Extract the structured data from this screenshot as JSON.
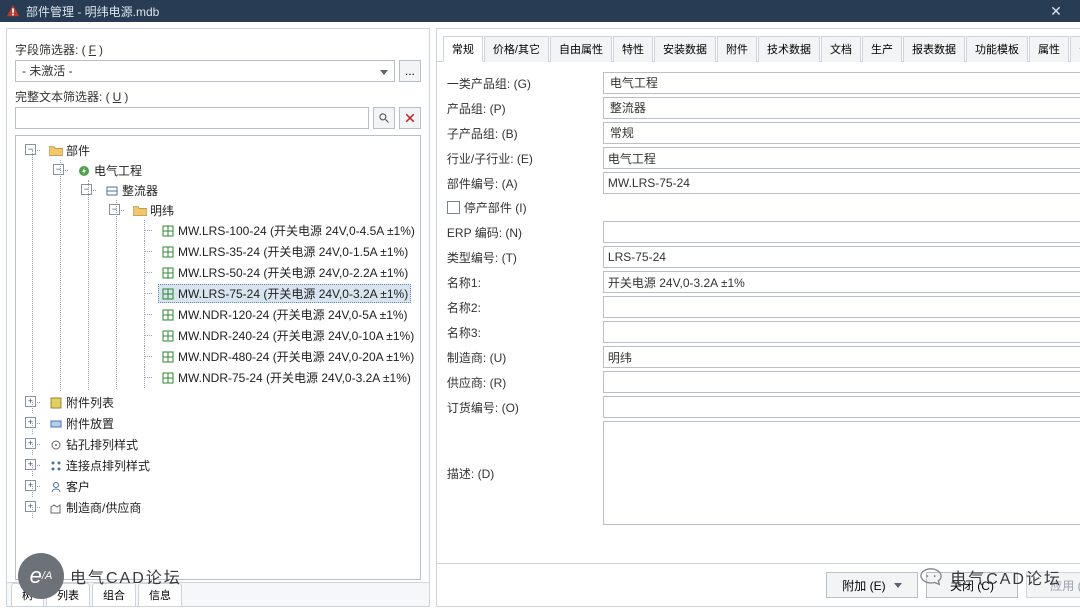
{
  "window": {
    "title": "部件管理 - 明纬电源.mdb"
  },
  "left": {
    "field_filter_label": "字段筛选器: (",
    "field_filter_u": "F",
    "field_filter_close": ")",
    "field_filter_value": "- 未激活 -",
    "full_filter_label": "完整文本筛选器: (",
    "full_filter_u": "U",
    "full_filter_close": ")",
    "root": "部件",
    "branch1": "电气工程",
    "branch2": "整流器",
    "branch3": "明纬",
    "leaves": [
      "MW.LRS-100-24 (开关电源 24V,0-4.5A ±1%)",
      "MW.LRS-35-24 (开关电源 24V,0-1.5A ±1%)",
      "MW.LRS-50-24 (开关电源 24V,0-2.2A ±1%)",
      "MW.LRS-75-24 (开关电源 24V,0-3.2A ±1%)",
      "MW.NDR-120-24 (开关电源 24V,0-5A ±1%)",
      "MW.NDR-240-24 (开关电源 24V,0-10A ±1%)",
      "MW.NDR-480-24 (开关电源 24V,0-20A ±1%)",
      "MW.NDR-75-24 (开关电源 24V,0-3.2A ±1%)"
    ],
    "other_roots": [
      "附件列表",
      "附件放置",
      "钻孔排列样式",
      "连接点排列样式",
      "客户",
      "制造商/供应商"
    ],
    "bottom_tabs": [
      "树",
      "列表",
      "组合",
      "信息"
    ]
  },
  "right": {
    "tabs": [
      "常规",
      "价格/其它",
      "自由属性",
      "特性",
      "安装数据",
      "附件",
      "技术数据",
      "文档",
      "生产",
      "报表数据",
      "功能模板",
      "属性",
      "安全值"
    ],
    "fields": {
      "group1": {
        "label": "一类产品组: (G)",
        "value": "电气工程",
        "type": "select"
      },
      "group2": {
        "label": "产品组: (P)",
        "value": "整流器",
        "type": "select"
      },
      "group3": {
        "label": "子产品组: (B)",
        "value": "常规",
        "type": "select"
      },
      "industry": {
        "label": "行业/子行业: (E)",
        "value": "电气工程",
        "type": "input-el"
      },
      "part_no": {
        "label": "部件编号: (A)",
        "value": "MW.LRS-75-24",
        "type": "input"
      },
      "discontinued": {
        "label": "停产部件 (I)",
        "type": "check"
      },
      "erp": {
        "label": "ERP 编码: (N)",
        "value": "",
        "type": "input"
      },
      "type_no": {
        "label": "类型编号: (T)",
        "value": "LRS-75-24",
        "type": "input"
      },
      "name1": {
        "label": "名称1: ",
        "value": "开关电源 24V,0-3.2A ±1%",
        "type": "input"
      },
      "name2": {
        "label": "名称2: ",
        "value": "",
        "type": "input"
      },
      "name3": {
        "label": "名称3: ",
        "value": "",
        "type": "input"
      },
      "mfr": {
        "label": "制造商: (U)",
        "value": "明纬",
        "type": "input-el"
      },
      "supplier": {
        "label": "供应商: (R)",
        "value": "",
        "type": "input-el"
      },
      "order_no": {
        "label": "订货编号: (O)",
        "value": "",
        "type": "input"
      },
      "desc": {
        "label": "描述: (D)",
        "value": "",
        "type": "textarea"
      }
    },
    "footer": {
      "extras": "附加 (E)",
      "close": "关闭 (C)",
      "apply": "应用 (A)"
    }
  },
  "wm1": "电气CAD论坛",
  "wm2": "电气CAD论坛"
}
